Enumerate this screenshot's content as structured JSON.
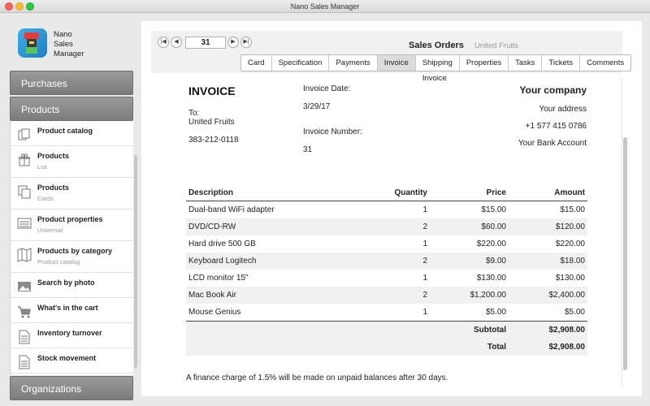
{
  "window": {
    "title": "Nano Sales Manager"
  },
  "app": {
    "name_lines": [
      "Nano",
      "Sales",
      "Manager"
    ]
  },
  "sidebar": {
    "sections": [
      "Purchases",
      "Products",
      "Organizations"
    ],
    "items": [
      {
        "label": "Product catalog",
        "sub": "",
        "icon": "catalog-icon"
      },
      {
        "label": "Products",
        "sub": "List",
        "icon": "gift-icon"
      },
      {
        "label": "Products",
        "sub": "Cards",
        "icon": "cards-icon"
      },
      {
        "label": "Product properties",
        "sub": "Universal",
        "icon": "properties-icon"
      },
      {
        "label": "Products by category",
        "sub": "Product catalog",
        "icon": "map-icon"
      },
      {
        "label": "Search by photo",
        "sub": "",
        "icon": "photo-icon"
      },
      {
        "label": "What's in the cart",
        "sub": "",
        "icon": "cart-icon"
      },
      {
        "label": "Inventory turnover",
        "sub": "",
        "icon": "document-icon"
      },
      {
        "label": "Stock movement",
        "sub": "",
        "icon": "document-icon"
      }
    ]
  },
  "toolbar": {
    "page": "31",
    "title": "Sales Orders",
    "subtitle": "United Fruits",
    "tabs": [
      "Card",
      "Specification",
      "Payments",
      "Invoice",
      "Shipping Invoice",
      "Properties",
      "Tasks",
      "Tickets",
      "Comments"
    ],
    "active_tab": "Invoice"
  },
  "invoice": {
    "heading": "INVOICE",
    "to_label": "To:",
    "to_name": "United Fruits",
    "to_phone": "383-212-0118",
    "date_label": "Invoice Date:",
    "date": "3/29/17",
    "number_label": "Invoice Number:",
    "number": "31",
    "company": "Your company",
    "address": "Your address",
    "phone": "+1 577 415 0786",
    "bank": "Your Bank Account",
    "columns": {
      "desc": "Description",
      "qty": "Quantity",
      "price": "Price",
      "amount": "Amount"
    },
    "rows": [
      {
        "desc": "Dual-band WiFi adapter",
        "qty": "1",
        "price": "$15.00",
        "amount": "$15.00"
      },
      {
        "desc": "DVD/CD-RW",
        "qty": "2",
        "price": "$60.00",
        "amount": "$120.00"
      },
      {
        "desc": "Hard drive 500 GB",
        "qty": "1",
        "price": "$220.00",
        "amount": "$220.00"
      },
      {
        "desc": "Keyboard Logitech",
        "qty": "2",
        "price": "$9.00",
        "amount": "$18.00"
      },
      {
        "desc": "LCD monitor 15\"",
        "qty": "1",
        "price": "$130.00",
        "amount": "$130.00"
      },
      {
        "desc": "Mac Book Air",
        "qty": "2",
        "price": "$1,200.00",
        "amount": "$2,400.00"
      },
      {
        "desc": "Mouse Genius",
        "qty": "1",
        "price": "$5.00",
        "amount": "$5.00"
      }
    ],
    "subtotal_label": "Subtotal",
    "subtotal": "$2,908.00",
    "total_label": "Total",
    "total": "$2,908.00",
    "finance_note": "A finance charge of 1.5% will be made on unpaid balances after 30 days."
  }
}
